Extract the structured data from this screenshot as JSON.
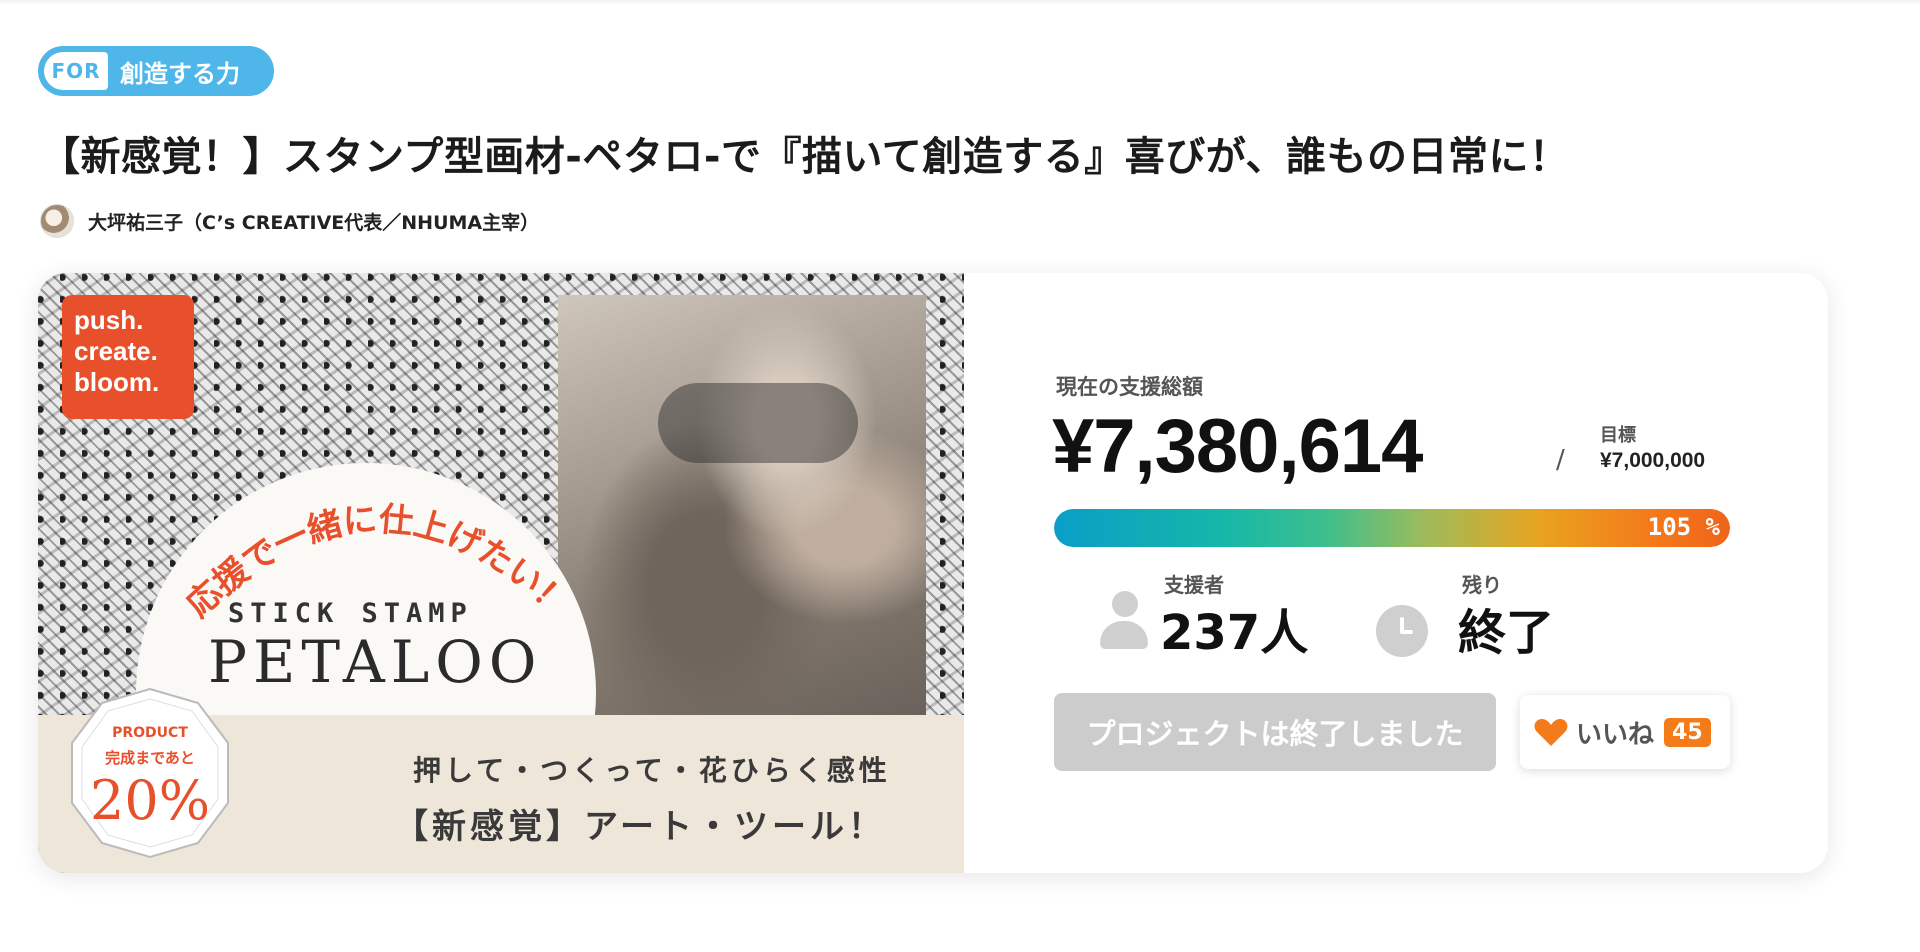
{
  "category_tag": {
    "for_label": "FOR",
    "text": "創造する力"
  },
  "project": {
    "title": "【新感覚！】スタンプ型画材-ペタロ-で『描いて創造する』喜びが、誰もの日常に！",
    "owner": "大坪祐三子（C’s CREATIVE代表／NHUMA主宰）"
  },
  "hero_image": {
    "badge_lines": [
      "push.",
      "create.",
      "bloom."
    ],
    "catchphrase": "応援で一緒に仕上げたい！",
    "product_label": "STICK  STAMP",
    "product_name": "PETALOO",
    "seal": {
      "line1": "PRODUCT",
      "line2": "完成まであと",
      "percent": "20%"
    },
    "tagline1": "押して・つくって・花ひらく感性",
    "tagline2": "【新感覚】アート・ツール！"
  },
  "funding": {
    "total_label": "現在の支援総額",
    "total_amount": "¥7,380,614",
    "goal_separator": "/",
    "goal_label": "目標",
    "goal_amount": "¥7,000,000",
    "progress_text": "105 %",
    "progress_fraction": 1.0
  },
  "stats": {
    "backers_label": "支援者",
    "backers_value": "237人",
    "remaining_label": "残り",
    "remaining_value": "終了"
  },
  "actions": {
    "ended_label": "プロジェクトは終了しました",
    "like_label": "いいね",
    "like_count": "45"
  },
  "colors": {
    "accent_blue": "#4eb6e8",
    "accent_orange": "#f47b1a",
    "hero_red": "#e8502c",
    "disabled_gray": "#cccccc"
  },
  "icons": {
    "backers": "person-icon",
    "remaining": "clock-icon",
    "like": "heart-icon"
  }
}
